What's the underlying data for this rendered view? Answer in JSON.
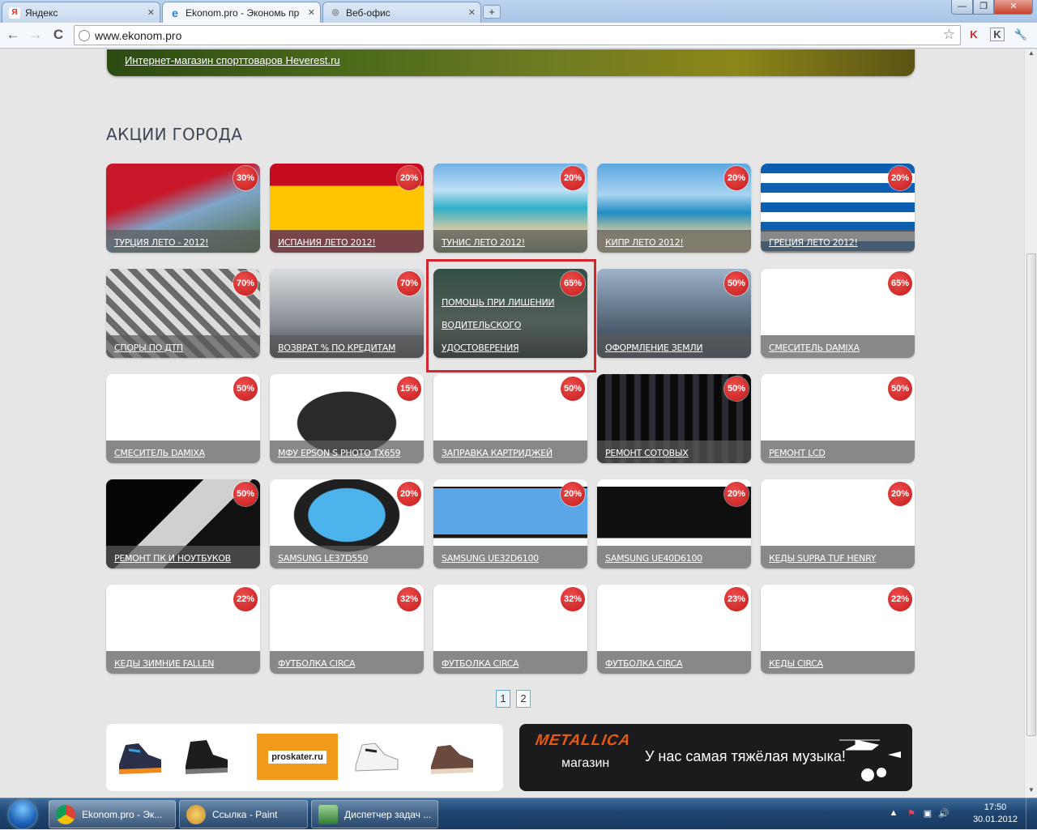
{
  "browser": {
    "tabs": [
      {
        "label": "Яндекс",
        "icon": "yandex-icon",
        "icon_glyph": "Я",
        "icon_color": "#e52620"
      },
      {
        "label": "Ekonom.pro - Экономь пр",
        "icon": "ie-icon",
        "icon_glyph": "e",
        "icon_color": "#2a7fd4"
      },
      {
        "label": "Веб-офис",
        "icon": "globe-icon",
        "icon_glyph": "◎",
        "icon_color": "#777777"
      }
    ],
    "new_tab": "+",
    "url": "www.ekonom.pro",
    "window_buttons": {
      "minimize": "—",
      "maximize": "❐",
      "close": "✕"
    },
    "nav": {
      "back": "←",
      "forward": "→",
      "reload": "C"
    },
    "star": "☆",
    "extensions": [
      "K",
      "K",
      "🔧"
    ]
  },
  "page": {
    "banner_link": "Интернет-магазин спорттоваров Heverest.ru",
    "section_title": "АКЦИИ ГОРОДА",
    "cards": [
      {
        "title": "ТУРЦИЯ ЛЕТО - 2012!",
        "discount": "30%",
        "theme": "turkey"
      },
      {
        "title": "ИСПАНИЯ ЛЕТО 2012!",
        "discount": "20%",
        "theme": "spain"
      },
      {
        "title": "ТУНИС ЛЕТО 2012!",
        "discount": "20%",
        "theme": "beach"
      },
      {
        "title": "КИПР ЛЕТО 2012!",
        "discount": "20%",
        "theme": "beach2"
      },
      {
        "title": "ГРЕЦИЯ ЛЕТО 2012!",
        "discount": "20%",
        "theme": "greece"
      },
      {
        "title": "СПОРЫ ПО ДТП",
        "discount": "70%",
        "theme": "crash"
      },
      {
        "title": "ВОЗВРАТ % ПО КРЕДИТАМ",
        "discount": "70%",
        "theme": "office"
      },
      {
        "title": "ПОМОЩЬ ПРИ ЛИШЕНИИ ВОДИТЕЛЬСКОГО УДОСТОВЕРЕНИЯ",
        "discount": "65%",
        "theme": "car"
      },
      {
        "title": "ОФОРМЛЕНИЕ ЗЕМЛИ",
        "discount": "50%",
        "theme": "city"
      },
      {
        "title": "СМЕСИТЕЛЬ DAMIXA",
        "discount": "65%",
        "theme": "white"
      },
      {
        "title": "СМЕСИТЕЛЬ DAMIXA",
        "discount": "50%",
        "theme": "white"
      },
      {
        "title": "МФУ EPSON S PHOTO TX659",
        "discount": "15%",
        "theme": "printer"
      },
      {
        "title": "ЗАПРАВКА КАРТРИДЖЕЙ",
        "discount": "50%",
        "theme": "white"
      },
      {
        "title": "РЕМОНТ СОТОВЫХ",
        "discount": "50%",
        "theme": "phones"
      },
      {
        "title": "РЕМОНТ LCD",
        "discount": "50%",
        "theme": "white"
      },
      {
        "title": "РЕМОНТ ПК И НОУТБУКОВ",
        "discount": "50%",
        "theme": "laptop"
      },
      {
        "title": "SAMSUNG LE37D550",
        "discount": "20%",
        "theme": "samsung"
      },
      {
        "title": "SAMSUNG UE32D6100",
        "discount": "20%",
        "theme": "tv"
      },
      {
        "title": "SAMSUNG UE40D6100",
        "discount": "20%",
        "theme": "tvdark"
      },
      {
        "title": "КЕДЫ SUPRA TUF HENRY",
        "discount": "20%",
        "theme": "white"
      },
      {
        "title": "КЕДЫ ЗИМНИЕ FALLEN",
        "discount": "22%",
        "theme": "white"
      },
      {
        "title": "ФУТБОЛКА CIRCA",
        "discount": "32%",
        "theme": "white"
      },
      {
        "title": "ФУТБОЛКА CIRCA",
        "discount": "32%",
        "theme": "white"
      },
      {
        "title": "ФУТБОЛКА CIRCA",
        "discount": "23%",
        "theme": "white"
      },
      {
        "title": "КЕДЫ CIRCA",
        "discount": "22%",
        "theme": "white"
      }
    ],
    "pagination": [
      "1",
      "2"
    ],
    "promo_proskater": "proskater.ru",
    "promo_metallica": {
      "logo": "METALLICA",
      "sub": "магазин",
      "slogan": "У нас самая тяжёлая музыка!"
    }
  },
  "taskbar": {
    "items": [
      {
        "label": "Ekonom.pro - Эк...",
        "icon": "chrome-icon"
      },
      {
        "label": "Ссылка - Paint",
        "icon": "paint-icon"
      },
      {
        "label": "Диспетчер задач ...",
        "icon": "task-manager-icon"
      }
    ],
    "time": "17:50",
    "date": "30.01.2012",
    "tray_icons": [
      "▲",
      "⚑",
      "▣",
      "🔊"
    ]
  },
  "colors": {
    "badge": "#d42a2a",
    "highlight": "#d4262f",
    "taskbar": "#1f4570"
  }
}
